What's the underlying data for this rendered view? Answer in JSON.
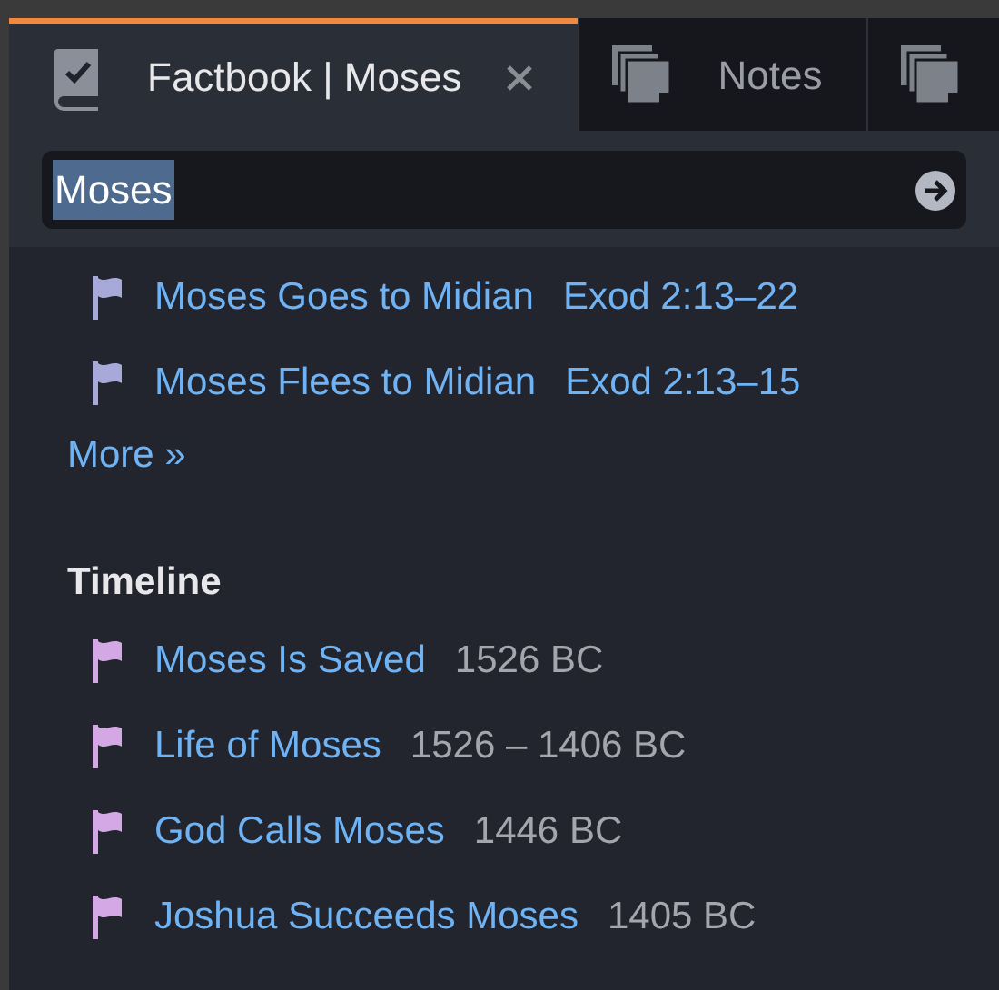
{
  "tabs": [
    {
      "kind": "factbook",
      "label": "Factbook | Moses",
      "selected": true,
      "closable": true
    },
    {
      "kind": "notes",
      "label": "Notes",
      "selected": false,
      "closable": false
    },
    {
      "kind": "notes",
      "selected": false,
      "closable": false
    }
  ],
  "search": {
    "value": "Moses",
    "text_selected": true
  },
  "events": [
    {
      "title": "Moses Goes to Midian",
      "reference": "Exod 2:13–22",
      "color": "#a7a9d8"
    },
    {
      "title": "Moses Flees to Midian",
      "reference": "Exod 2:13–15",
      "color": "#a7a9d8"
    }
  ],
  "more_link": "More »",
  "timeline": {
    "heading": "Timeline",
    "items": [
      {
        "title": "Moses Is Saved",
        "date": "1526 BC",
        "color": "#d4a8e4"
      },
      {
        "title": "Life of Moses",
        "date": "1526 – 1406 BC",
        "color": "#d4a8e4"
      },
      {
        "title": "God Calls Moses",
        "date": "1446 BC",
        "color": "#d4a8e4"
      },
      {
        "title": "Joshua Succeeds Moses",
        "date": "1405 BC",
        "color": "#d4a8e4"
      }
    ]
  }
}
